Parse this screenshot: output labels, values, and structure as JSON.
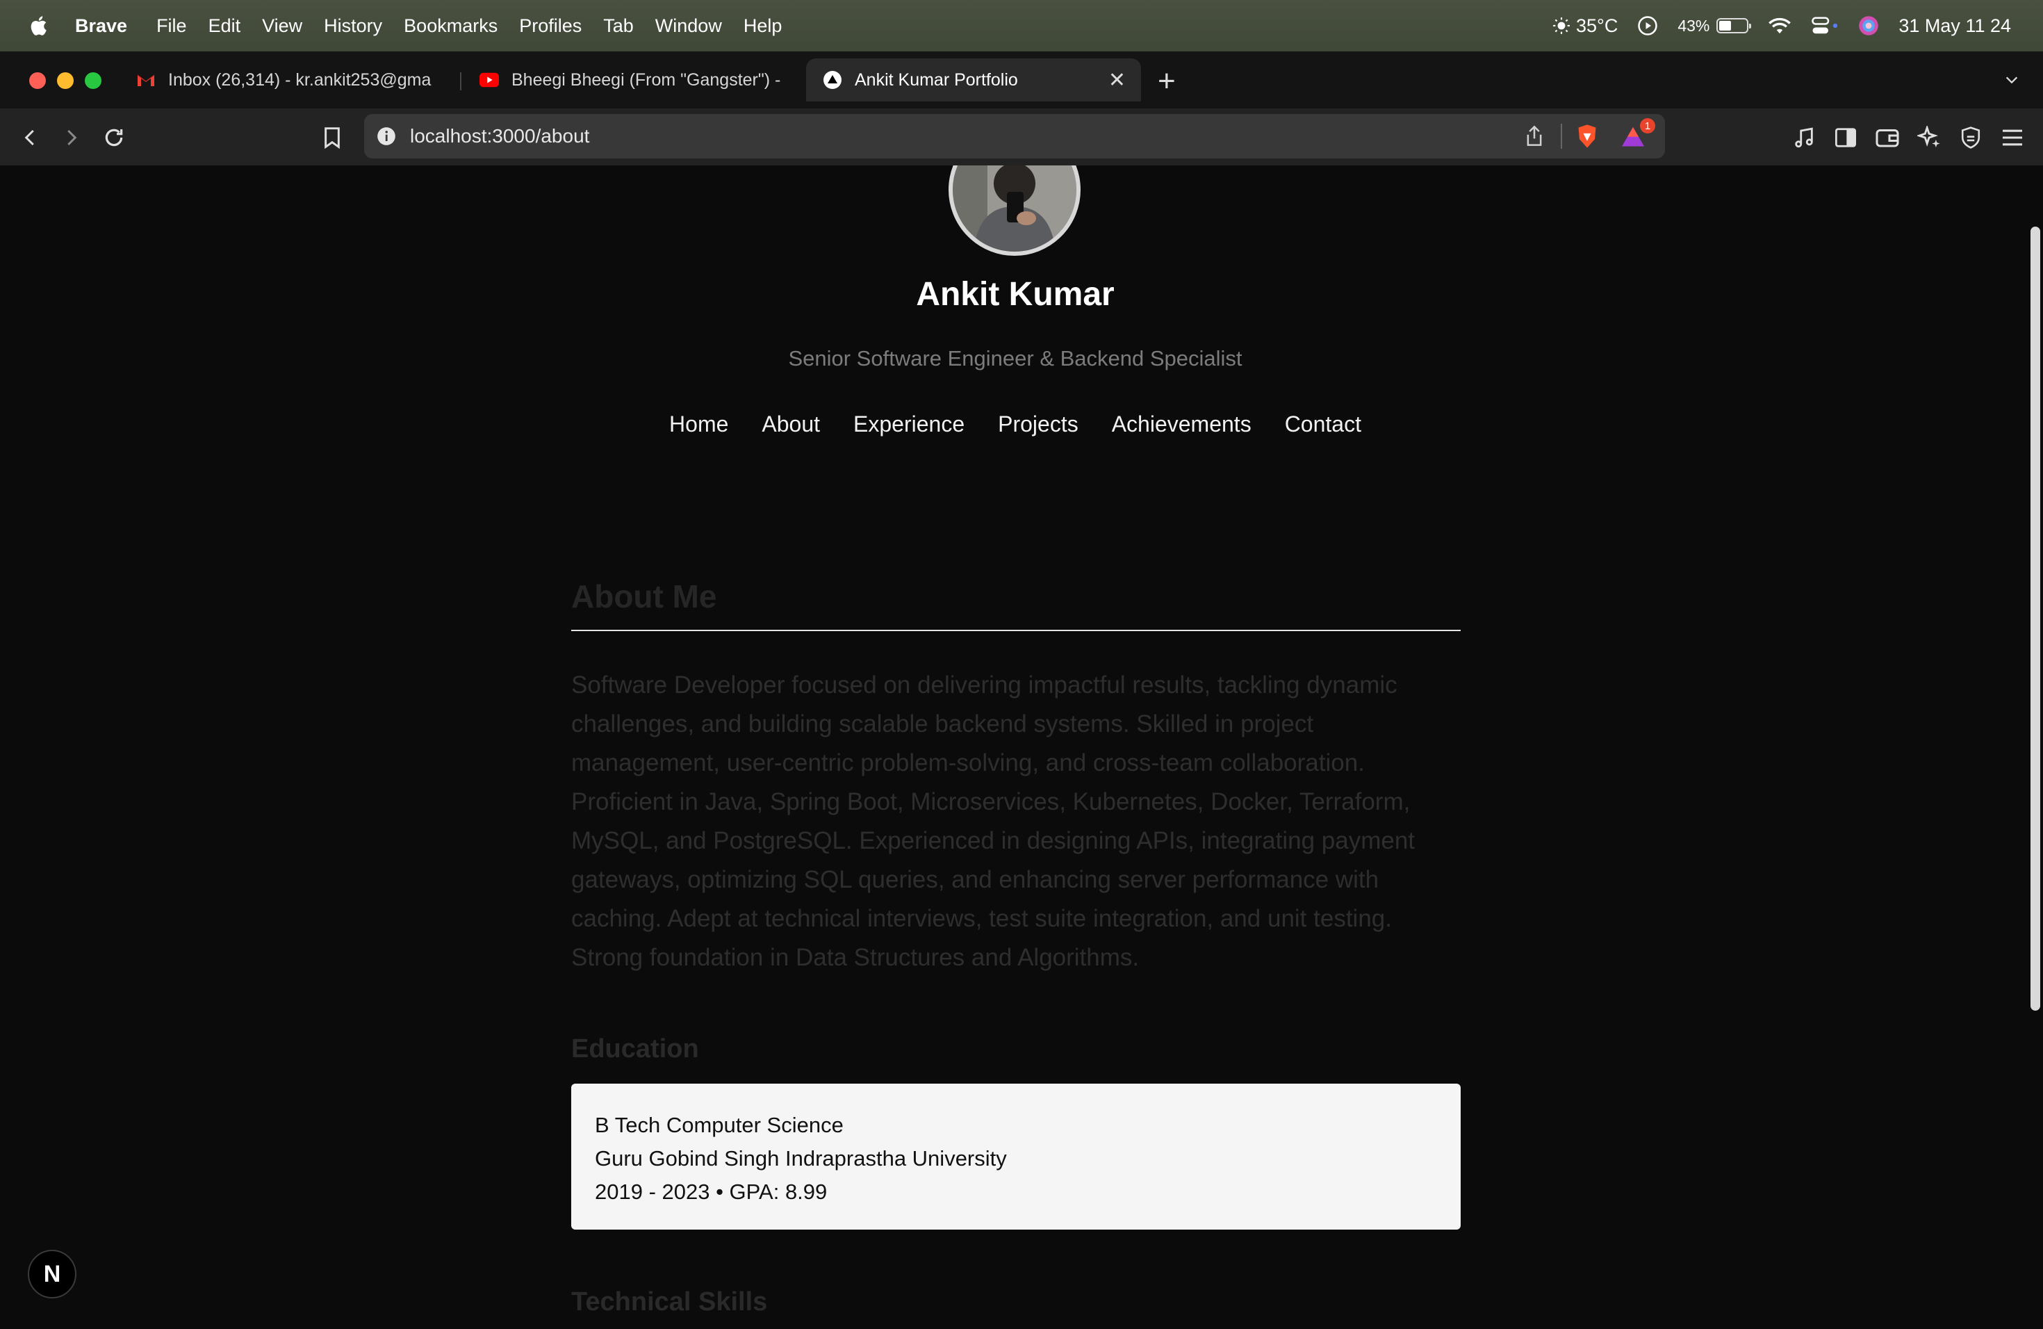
{
  "menubar": {
    "app": "Brave",
    "items": [
      "File",
      "Edit",
      "View",
      "History",
      "Bookmarks",
      "Profiles",
      "Tab",
      "Window",
      "Help"
    ],
    "weather": "35°C",
    "battery_percent": "43%",
    "battery_level": 0.43,
    "datetime": "31 May  11 24"
  },
  "tabs": [
    {
      "title": "Inbox (26,314) - kr.ankit253@gma",
      "icon": "gmail-icon"
    },
    {
      "title": "Bheegi Bheegi (From \"Gangster\") -",
      "icon": "youtube-icon"
    },
    {
      "title": "Ankit Kumar Portfolio",
      "icon": "vercel-icon",
      "active": true
    }
  ],
  "address_bar": {
    "url": "localhost:3000/about",
    "rewards_badge": "1"
  },
  "profile": {
    "name": "Ankit Kumar",
    "subtitle": "Senior Software Engineer & Backend Specialist"
  },
  "nav": [
    "Home",
    "About",
    "Experience",
    "Projects",
    "Achievements",
    "Contact"
  ],
  "about": {
    "title": "About Me",
    "text": "Software Developer focused on delivering impactful results, tackling dynamic challenges, and building scalable backend systems. Skilled in project management, user-centric problem-solving, and cross-team collaboration. Proficient in Java, Spring Boot, Microservices, Kubernetes, Docker, Terraform, MySQL, and PostgreSQL. Experienced in designing APIs, integrating payment gateways, optimizing SQL queries, and enhancing server performance with caching. Adept at technical interviews, test suite integration, and unit testing. Strong foundation in Data Structures and Algorithms."
  },
  "education": {
    "title": "Education",
    "degree": "B Tech Computer Science",
    "university": "Guru Gobind Singh Indraprastha University",
    "details": "2019 - 2023 • GPA: 8.99"
  },
  "skills": {
    "title": "Technical Skills"
  },
  "dev_badge": "N",
  "colors": {
    "background": "#0b0b0b",
    "card": "#f5f5f5",
    "muted_text": "#2e2e2e"
  }
}
